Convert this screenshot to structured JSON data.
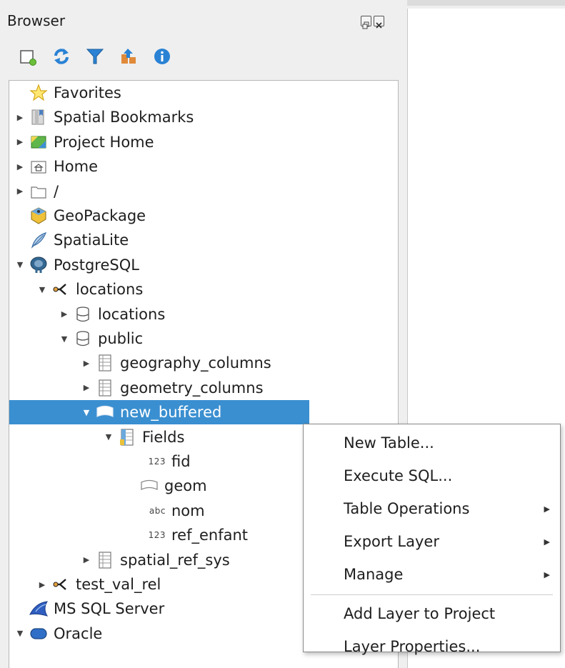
{
  "panel": {
    "title": "Browser"
  },
  "toolbar": [
    {
      "name": "add-selected-layers-button",
      "icon": "add-layer-icon"
    },
    {
      "name": "refresh-button",
      "icon": "refresh-icon"
    },
    {
      "name": "filter-button",
      "icon": "filter-icon"
    },
    {
      "name": "collapse-all-button",
      "icon": "collapse-icon"
    },
    {
      "name": "properties-button",
      "icon": "info-icon"
    }
  ],
  "tree": [
    {
      "label": "Favorites",
      "level": 0,
      "arrow": "",
      "icon": "star-icon"
    },
    {
      "label": "Spatial Bookmarks",
      "level": 0,
      "arrow": "right",
      "icon": "bookmark-icon"
    },
    {
      "label": "Project Home",
      "level": 0,
      "arrow": "right",
      "icon": "project-home-icon"
    },
    {
      "label": "Home",
      "level": 0,
      "arrow": "right",
      "icon": "home-folder-icon"
    },
    {
      "label": "/",
      "level": 0,
      "arrow": "right",
      "icon": "folder-icon"
    },
    {
      "label": "GeoPackage",
      "level": 0,
      "arrow": "",
      "icon": "geopackage-icon"
    },
    {
      "label": "SpatiaLite",
      "level": 0,
      "arrow": "",
      "icon": "feather-icon"
    },
    {
      "label": "PostgreSQL",
      "level": 0,
      "arrow": "down",
      "icon": "postgresql-icon"
    },
    {
      "label": "locations",
      "level": 1,
      "arrow": "down",
      "icon": "connection-icon"
    },
    {
      "label": "locations",
      "level": 2,
      "arrow": "right",
      "icon": "database-icon"
    },
    {
      "label": "public",
      "level": 2,
      "arrow": "down",
      "icon": "database-icon"
    },
    {
      "label": "geography_columns",
      "level": 3,
      "arrow": "right",
      "icon": "table-icon"
    },
    {
      "label": "geometry_columns",
      "level": 3,
      "arrow": "right",
      "icon": "table-icon"
    },
    {
      "label": "new_buffered",
      "level": 3,
      "arrow": "down",
      "icon": "polygon-layer-icon",
      "selected": true
    },
    {
      "label": "Fields",
      "level": 4,
      "arrow": "down",
      "icon": "fields-icon"
    },
    {
      "label": "fid",
      "level": 5,
      "arrow": "",
      "type": "123"
    },
    {
      "label": "geom",
      "level": 5,
      "arrow": "",
      "icon": "geometry-icon"
    },
    {
      "label": "nom",
      "level": 5,
      "arrow": "",
      "type": "abc"
    },
    {
      "label": "ref_enfant",
      "level": 5,
      "arrow": "",
      "type": "123"
    },
    {
      "label": "spatial_ref_sys",
      "level": 3,
      "arrow": "right",
      "icon": "table-icon"
    },
    {
      "label": "test_val_rel",
      "level": 1,
      "arrow": "right",
      "icon": "connection-icon"
    },
    {
      "label": "MS SQL Server",
      "level": 0,
      "arrow": "",
      "icon": "mssql-icon"
    },
    {
      "label": "Oracle",
      "level": 0,
      "arrow": "down",
      "icon": "oracle-icon"
    }
  ],
  "context_menu": [
    {
      "label": "New Table...",
      "submenu": false
    },
    {
      "label": "Execute SQL...",
      "submenu": false
    },
    {
      "label": "Table Operations",
      "submenu": true
    },
    {
      "label": "Export Layer",
      "submenu": true
    },
    {
      "label": "Manage",
      "submenu": true
    },
    {
      "separator": true
    },
    {
      "label": "Add Layer to Project",
      "submenu": false
    },
    {
      "label": "Layer Properties...",
      "submenu": false
    }
  ],
  "colors": {
    "selection": "#3a8fd0",
    "panel_bg": "#efefef"
  }
}
